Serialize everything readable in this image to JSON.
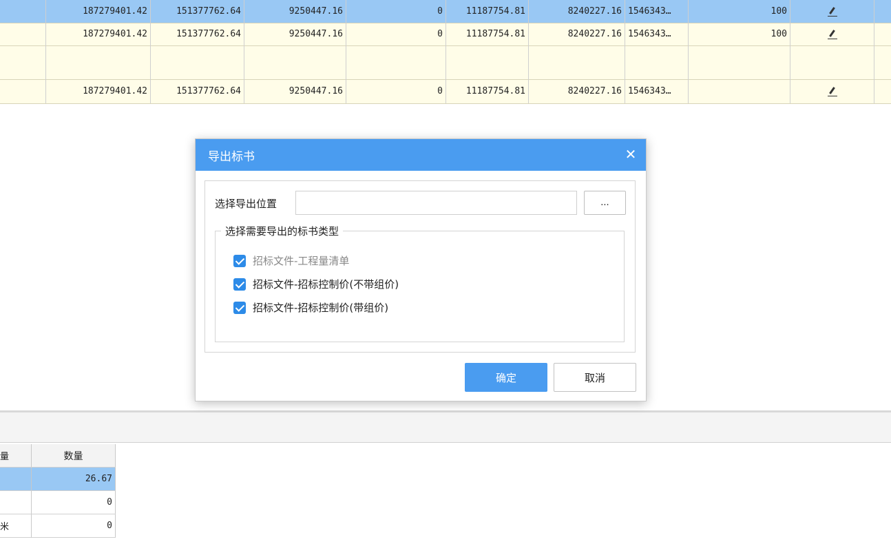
{
  "grid": {
    "rows": [
      {
        "c1": "187279401.42",
        "c2": "151377762.64",
        "c3": "9250447.16",
        "c4": "0",
        "c5": "11187754.81",
        "c6": "8240227.16",
        "c7": "1546343…",
        "c8": "100"
      },
      {
        "c1": "187279401.42",
        "c2": "151377762.64",
        "c3": "9250447.16",
        "c4": "0",
        "c5": "11187754.81",
        "c6": "8240227.16",
        "c7": "1546343…",
        "c8": "100"
      },
      {
        "c1": "",
        "c2": "",
        "c3": "",
        "c4": "",
        "c5": "",
        "c6": "",
        "c7": "",
        "c8": ""
      },
      {
        "c1": "187279401.42",
        "c2": "151377762.64",
        "c3": "9250447.16",
        "c4": "0",
        "c5": "11187754.81",
        "c6": "8240227.16",
        "c7": "1546343…",
        "c8": ""
      }
    ]
  },
  "bottom_table": {
    "header": {
      "col1": "量",
      "col2": "数量"
    },
    "rows": [
      {
        "col1": "",
        "col2": "26.67"
      },
      {
        "col1": "",
        "col2": "0"
      },
      {
        "col1": "米",
        "col2": "0"
      }
    ]
  },
  "dialog": {
    "title": "导出标书",
    "close_glyph": "✕",
    "location_label": "选择导出位置",
    "location_value": "",
    "browse_label": "...",
    "group_label": "选择需要导出的标书类型",
    "options": [
      {
        "label": "招标文件-工程量清单",
        "checked": true,
        "disabled": true
      },
      {
        "label": "招标文件-招标控制价(不带组价)",
        "checked": true,
        "disabled": false
      },
      {
        "label": "招标文件-招标控制价(带组价)",
        "checked": true,
        "disabled": false
      }
    ],
    "ok_label": "确定",
    "cancel_label": "取消"
  },
  "colors": {
    "accent": "#4a9cf0",
    "selected_row": "#99c8f4",
    "grid_bg": "#fffde8",
    "checkbox": "#2d8be8"
  }
}
